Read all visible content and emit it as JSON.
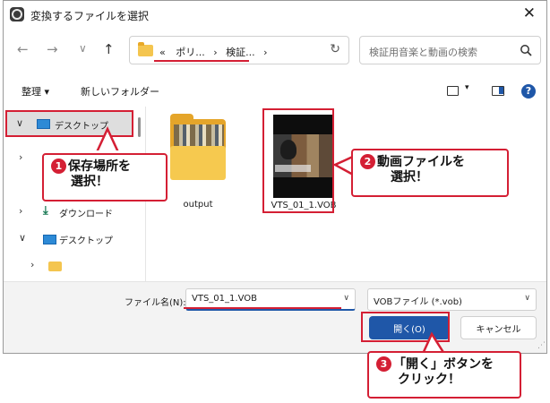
{
  "window": {
    "title": "変換するファイルを選択",
    "close_glyph": "✕"
  },
  "nav": {
    "back_glyph": "←",
    "forward_glyph": "→",
    "recent_glyph": "∨",
    "up_glyph": "↑",
    "breadcrumb": {
      "overflow": "«",
      "items": [
        "ポリ...",
        "検証..."
      ],
      "separator": "›",
      "trail": "›"
    },
    "refresh_glyph": "↻"
  },
  "search": {
    "placeholder": "検証用音楽と動画の検索",
    "icon": "search-icon"
  },
  "toolbar": {
    "organize_label": "整理 ▾",
    "new_folder_label": "新しいフォルダー",
    "view_caret": "▾",
    "help_label": "?"
  },
  "sidebar": {
    "items": [
      {
        "label": "デスクトップ",
        "chevron": "∨",
        "selected": true
      },
      {
        "label": "",
        "chevron": "›"
      },
      {
        "label": "ダウンロード",
        "chevron": "›",
        "icon": "download-icon"
      },
      {
        "label": "デスクトップ",
        "chevron": "∨",
        "icon": "desktop-icon"
      },
      {
        "label": "",
        "chevron": "›",
        "icon": "folder-icon"
      }
    ]
  },
  "files": [
    {
      "name": "output",
      "type": "folder"
    },
    {
      "name": "VTS_01_1.VOB",
      "type": "video"
    }
  ],
  "bottom": {
    "filename_label": "ファイル名(N):",
    "filename_value": "VTS_01_1.VOB",
    "filetype_value": "VOBファイル (*.vob)",
    "open_label": "開く(O)",
    "cancel_label": "キャンセル",
    "caret": "∨"
  },
  "annotations": {
    "step1": {
      "number": "1",
      "line1": "保存場所を",
      "line2": "選択！"
    },
    "step2": {
      "number": "2",
      "line1": "動画ファイルを",
      "line2": "選択！"
    },
    "step3": {
      "number": "3",
      "line1": "「開く」ボタンを",
      "line2": "クリック！"
    }
  },
  "colors": {
    "accent": "#1f57a8",
    "annotation_red": "#d41f34",
    "folder_yellow": "#f6c94f"
  }
}
